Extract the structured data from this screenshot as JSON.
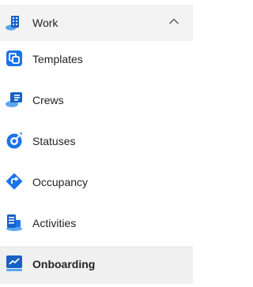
{
  "nav": {
    "group": {
      "label": "Work",
      "icon": "work-building-icon",
      "expanded": true
    },
    "items": [
      {
        "label": "Templates",
        "icon": "templates-icon",
        "selected": false
      },
      {
        "label": "Crews",
        "icon": "crews-icon",
        "selected": false
      },
      {
        "label": "Statuses",
        "icon": "statuses-icon",
        "selected": false
      },
      {
        "label": "Occupancy",
        "icon": "occupancy-icon",
        "selected": false
      },
      {
        "label": "Activities",
        "icon": "activities-icon",
        "selected": false
      },
      {
        "label": "Onboarding",
        "icon": "onboarding-icon",
        "selected": true
      }
    ]
  },
  "colors": {
    "accent_blue": "#1a73e8",
    "header_bg": "#f3f3f3",
    "selected_bg": "#f0f0f0",
    "text": "#242424"
  }
}
